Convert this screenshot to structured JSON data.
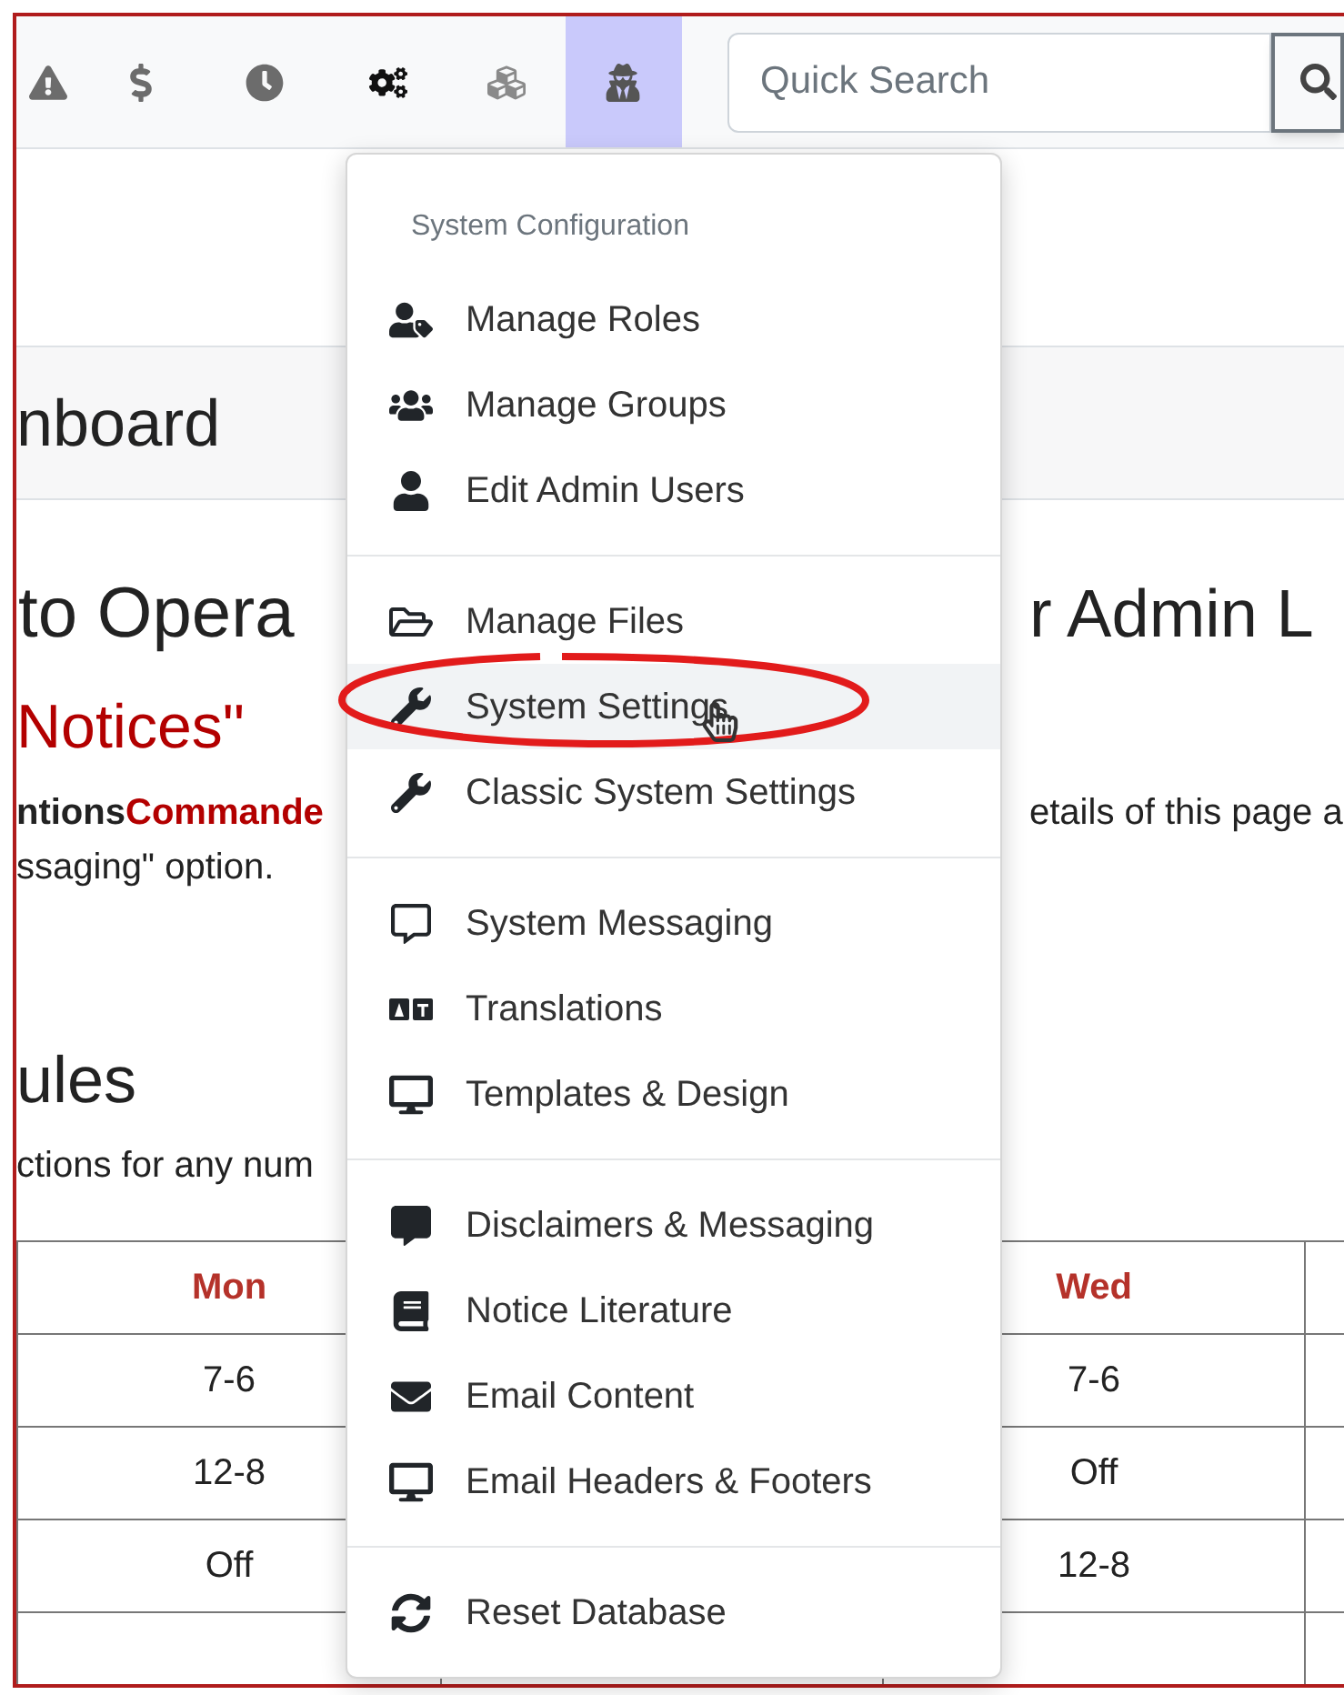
{
  "toolbar": {
    "buttons": [
      {
        "selected": false
      },
      {
        "selected": false
      },
      {
        "selected": false
      },
      {
        "selected": false
      },
      {
        "selected": false
      },
      {
        "selected": true
      }
    ],
    "search": {
      "placeholder": "Quick Search"
    }
  },
  "page": {
    "banner_title": "nboard",
    "heading_left": "to Opera",
    "heading_right": "r Admin L",
    "notice_title": "Notices\"",
    "paragraph_left": [
      {
        "kind": "plain",
        "text": "ntions"
      },
      {
        "kind": "highlight",
        "text": "Commande"
      }
    ],
    "paragraph_right": "etails of this page a",
    "paragraph_line2": "ssaging\" option.",
    "section_title": "ules",
    "section_text": "ctions for any num"
  },
  "table": {
    "columns": [
      {
        "header": "Mon",
        "cells": [
          "7-6",
          "12-8",
          "Off"
        ]
      },
      {
        "header": "Wed",
        "cells": [
          "7-6",
          "Off",
          "12-8"
        ]
      }
    ]
  },
  "menu": {
    "header": "System Configuration",
    "sections": [
      {
        "items": [
          {
            "label": "Manage Roles",
            "highlighted": false
          },
          {
            "label": "Manage Groups",
            "highlighted": false
          },
          {
            "label": "Edit Admin Users",
            "highlighted": false
          }
        ]
      },
      {
        "items": [
          {
            "label": "Manage Files",
            "highlighted": false
          },
          {
            "label": "System Settings",
            "highlighted": true
          },
          {
            "label": "Classic System Settings",
            "highlighted": false
          }
        ]
      },
      {
        "items": [
          {
            "label": "System Messaging",
            "highlighted": false
          },
          {
            "label": "Translations",
            "highlighted": false
          },
          {
            "label": "Templates & Design",
            "highlighted": false
          }
        ]
      },
      {
        "items": [
          {
            "label": "Disclaimers & Messaging",
            "highlighted": false
          },
          {
            "label": "Notice Literature",
            "highlighted": false
          },
          {
            "label": "Email Content",
            "highlighted": false
          },
          {
            "label": "Email Headers & Footers",
            "highlighted": false
          }
        ]
      },
      {
        "items": [
          {
            "label": "Reset Database",
            "highlighted": false
          }
        ]
      }
    ]
  }
}
